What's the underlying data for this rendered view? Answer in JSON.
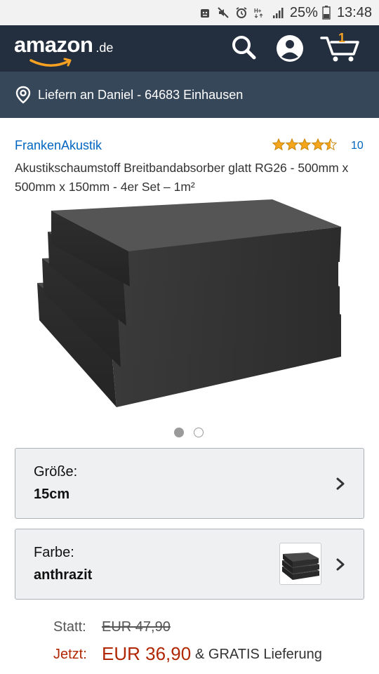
{
  "status_bar": {
    "battery": "25%",
    "time": "13:48",
    "icons": [
      "android-icon",
      "mute-icon",
      "alarm-icon",
      "hplus-icon",
      "signal-icon",
      "battery-icon"
    ]
  },
  "header": {
    "logo_text": "amazon",
    "logo_tld": ".de",
    "cart_count": "1",
    "icons": [
      "search-icon",
      "account-icon",
      "cart-icon"
    ]
  },
  "delivery": {
    "text": "Liefern an Daniel - 64683 Einhausen"
  },
  "product": {
    "brand": "FrankenAkustik",
    "rating": 4.5,
    "rating_count": "10",
    "title": "Akustikschaumstoff Breitbandabsorber glatt RG26 - 500mm x 500mm x 150mm - 4er Set – 1m²",
    "image_index": 1,
    "image_count": 2
  },
  "variations": {
    "size": {
      "label": "Größe:",
      "value": "15cm"
    },
    "color": {
      "label": "Farbe:",
      "value": "anthrazit"
    }
  },
  "price": {
    "statt_label": "Statt:",
    "statt_value": "EUR 47,90",
    "jetzt_label": "Jetzt:",
    "jetzt_value": "EUR 36,90",
    "delivery_note": "& GRATIS Lieferung"
  },
  "colors": {
    "header_bg": "#232f3e",
    "delivery_bg": "#37475a",
    "link": "#0066c0",
    "price": "#b12704",
    "star": "#f4a51c"
  }
}
